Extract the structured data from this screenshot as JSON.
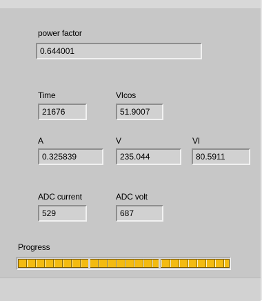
{
  "power_factor": {
    "label": "power factor",
    "value": "0.644001"
  },
  "time": {
    "label": "Time",
    "value": "21676"
  },
  "vicos": {
    "label": "VIcos",
    "value": "51.9007"
  },
  "current": {
    "label": "A",
    "value": "0.325839"
  },
  "voltage": {
    "label": "V",
    "value": "235.044"
  },
  "vi": {
    "label": "VI",
    "value": "80.5911"
  },
  "adc_current": {
    "label": "ADC current",
    "value": "529"
  },
  "adc_volt": {
    "label": "ADC volt",
    "value": "687"
  },
  "progress": {
    "label": "Progress",
    "fraction": 1.0
  },
  "colors": {
    "panel": "#c7c7c7",
    "progress_fill": "#f0b400"
  }
}
